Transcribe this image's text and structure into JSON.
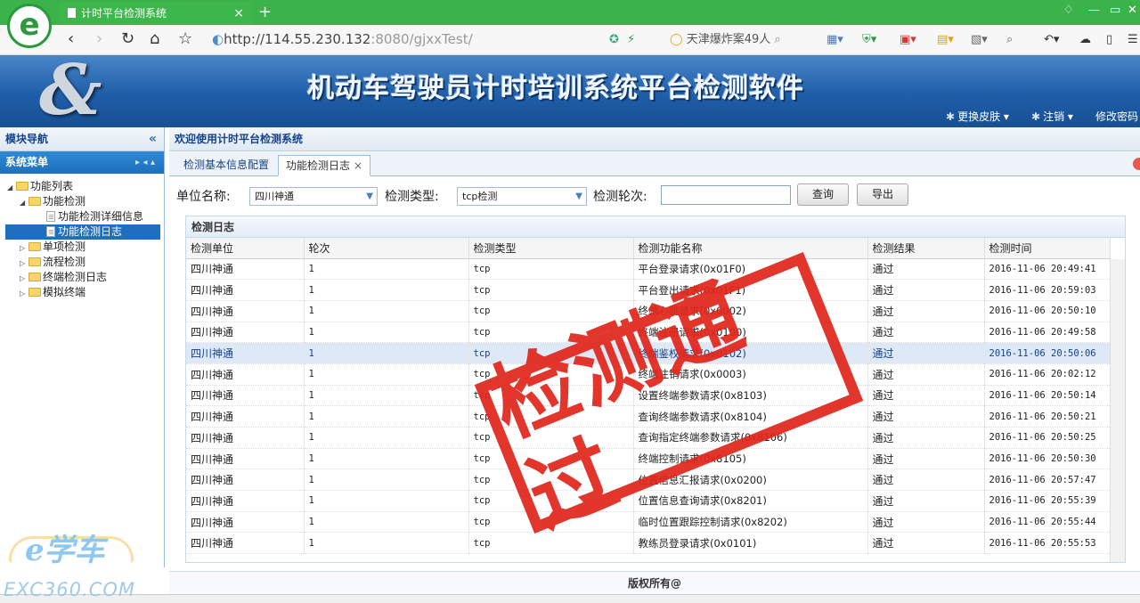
{
  "browser": {
    "tab_title": "计时平台检测系统",
    "url_host": "http://114.55.230.132",
    "url_rest": ":8080/gjxxTest/",
    "search_text": "天津爆炸案49人"
  },
  "banner": {
    "title": "机动车驾驶员计时培训系统平台检测软件",
    "menu": [
      "更换皮肤",
      "注销",
      "修改密码"
    ]
  },
  "sidebar": {
    "header": "模块导航",
    "section": "系统菜单",
    "tree": [
      {
        "label": "功能列表",
        "level": 0,
        "type": "folder",
        "state": "open"
      },
      {
        "label": "功能检测",
        "level": 1,
        "type": "folder",
        "state": "open"
      },
      {
        "label": "功能检测详细信息",
        "level": 2,
        "type": "page"
      },
      {
        "label": "功能检测日志",
        "level": 2,
        "type": "page",
        "selected": true
      },
      {
        "label": "单项检测",
        "level": 1,
        "type": "folder",
        "state": "closed"
      },
      {
        "label": "流程检测",
        "level": 1,
        "type": "folder",
        "state": "closed"
      },
      {
        "label": "终端检测日志",
        "level": 1,
        "type": "folder",
        "state": "closed"
      },
      {
        "label": "模拟终端",
        "level": 1,
        "type": "folder",
        "state": "closed"
      }
    ]
  },
  "main": {
    "welcome": "欢迎使用计时平台检测系统",
    "tabs": [
      {
        "label": "检测基本信息配置",
        "active": false
      },
      {
        "label": "功能检测日志",
        "active": true
      }
    ],
    "form": {
      "unit_label": "单位名称:",
      "unit_value": "四川神通",
      "type_label": "检测类型:",
      "type_value": "tcp检测",
      "round_label": "检测轮次:",
      "round_value": "",
      "query_button": "查询",
      "export_button": "导出"
    },
    "grid": {
      "title": "检测日志",
      "columns": [
        "检测单位",
        "轮次",
        "检测类型",
        "检测功能名称",
        "检测结果",
        "检测时间"
      ],
      "rows": [
        [
          "四川神通",
          "1",
          "tcp",
          "平台登录请求(0x01F0)",
          "通过",
          "2016-11-06 20:49:41"
        ],
        [
          "四川神通",
          "1",
          "tcp",
          "平台登出请求(0x01F1)",
          "通过",
          "2016-11-06 20:59:03"
        ],
        [
          "四川神通",
          "1",
          "tcp",
          "终端心跳请求(0x0002)",
          "通过",
          "2016-11-06 20:50:10"
        ],
        [
          "四川神通",
          "1",
          "tcp",
          "终端注册请求(0x0100)",
          "通过",
          "2016-11-06 20:49:58"
        ],
        [
          "四川神通",
          "1",
          "tcp",
          "终端鉴权请求(0x0102)",
          "通过",
          "2016-11-06 20:50:06"
        ],
        [
          "四川神通",
          "1",
          "tcp",
          "终端注销请求(0x0003)",
          "通过",
          "2016-11-06 20:02:12"
        ],
        [
          "四川神通",
          "1",
          "tcp",
          "设置终端参数请求(0x8103)",
          "通过",
          "2016-11-06 20:50:14"
        ],
        [
          "四川神通",
          "1",
          "tcp",
          "查询终端参数请求(0x8104)",
          "通过",
          "2016-11-06 20:50:21"
        ],
        [
          "四川神通",
          "1",
          "tcp",
          "查询指定终端参数请求(0x8106)",
          "通过",
          "2016-11-06 20:50:25"
        ],
        [
          "四川神通",
          "1",
          "tcp",
          "终端控制请求(0x8105)",
          "通过",
          "2016-11-06 20:50:30"
        ],
        [
          "四川神通",
          "1",
          "tcp",
          "位置信息汇报请求(0x0200)",
          "通过",
          "2016-11-06 20:57:47"
        ],
        [
          "四川神通",
          "1",
          "tcp",
          "位置信息查询请求(0x8201)",
          "通过",
          "2016-11-06 20:55:39"
        ],
        [
          "四川神通",
          "1",
          "tcp",
          "临时位置跟踪控制请求(0x8202)",
          "通过",
          "2016-11-06 20:55:44"
        ],
        [
          "四川神通",
          "1",
          "tcp",
          "教练员登录请求(0x0101)",
          "通过",
          "2016-11-06 20:55:53"
        ]
      ],
      "highlight_row": 4
    },
    "footer": "版权所有@"
  },
  "overlay": {
    "stamp_text": "检测通过",
    "stamp_color": "#e0261c",
    "watermark_brand": "e学车",
    "watermark_url": "EXC360.COM"
  }
}
